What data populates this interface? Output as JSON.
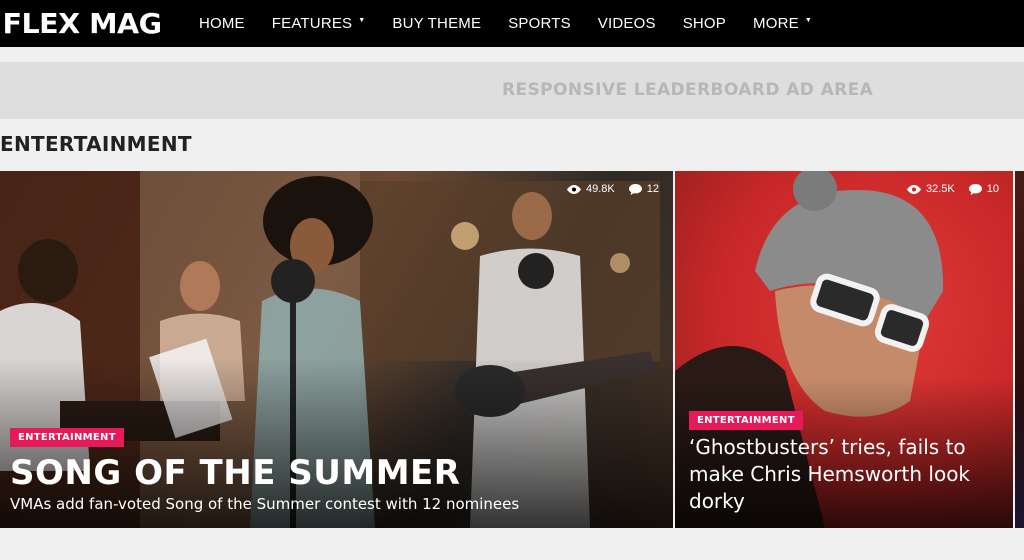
{
  "header": {
    "logo": "FLEX MAG",
    "menu": [
      {
        "label": "HOME",
        "has_dropdown": false
      },
      {
        "label": "FEATURES",
        "has_dropdown": true
      },
      {
        "label": "BUY THEME",
        "has_dropdown": false
      },
      {
        "label": "SPORTS",
        "has_dropdown": false
      },
      {
        "label": "VIDEOS",
        "has_dropdown": false
      },
      {
        "label": "SHOP",
        "has_dropdown": false
      },
      {
        "label": "MORE",
        "has_dropdown": true
      }
    ]
  },
  "ad": {
    "text": "RESPONSIVE LEADERBOARD AD AREA"
  },
  "section": {
    "title": "ENTERTAINMENT"
  },
  "featured": {
    "views": "49.8K",
    "comments": "12",
    "category": "ENTERTAINMENT",
    "title": "SONG OF THE SUMMER",
    "subtitle": "VMAs add fan-voted Song of the Summer contest with 12 nominees"
  },
  "side": {
    "views": "32.5K",
    "comments": "10",
    "category": "ENTERTAINMENT",
    "title": "‘Ghostbusters’ tries, fails to make Chris Hemsworth look dorky"
  },
  "colors": {
    "badge": "#e6195a",
    "nav_bg": "#000000",
    "side_bg": "#d32f2f"
  }
}
